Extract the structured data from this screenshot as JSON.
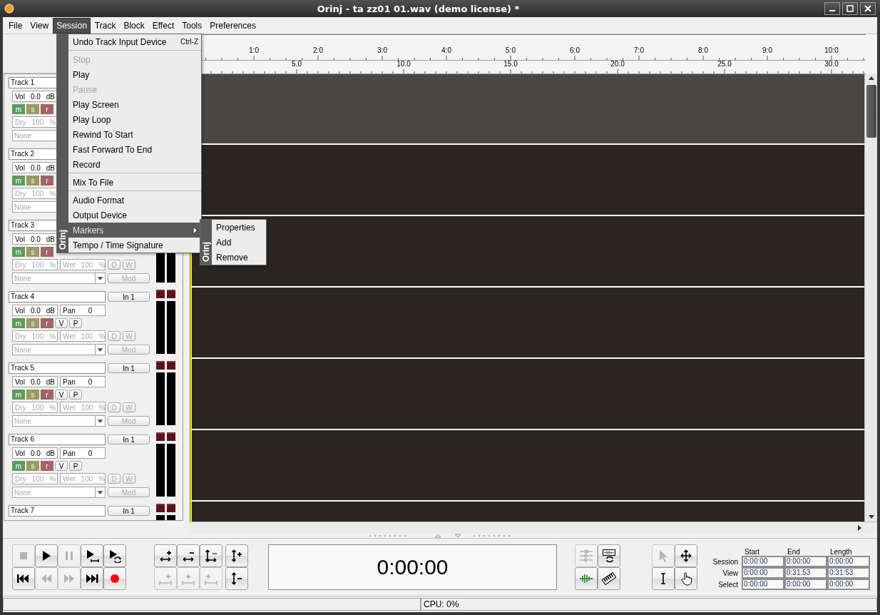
{
  "window": {
    "title": "Orinj - ta zz01 01.wav (demo license) *"
  },
  "menu_bar": [
    {
      "label": "File",
      "selected": false
    },
    {
      "label": "View",
      "selected": false
    },
    {
      "label": "Session",
      "selected": true
    },
    {
      "label": "Track",
      "selected": false
    },
    {
      "label": "Block",
      "selected": false
    },
    {
      "label": "Effect",
      "selected": false
    },
    {
      "label": "Tools",
      "selected": false
    },
    {
      "label": "Preferences",
      "selected": false
    }
  ],
  "session_menu": {
    "brand": "Orinj",
    "items": [
      {
        "kind": "item",
        "label": "Undo Track Input Device",
        "shortcut": "Ctrl-Z",
        "disabled": false,
        "highlighted": false
      },
      {
        "kind": "separator"
      },
      {
        "kind": "item",
        "label": "Stop",
        "disabled": true,
        "highlighted": false
      },
      {
        "kind": "item",
        "label": "Play",
        "disabled": false,
        "highlighted": false
      },
      {
        "kind": "item",
        "label": "Pause",
        "disabled": true,
        "highlighted": false
      },
      {
        "kind": "item",
        "label": "Play Screen",
        "disabled": false,
        "highlighted": false
      },
      {
        "kind": "item",
        "label": "Play Loop",
        "disabled": false,
        "highlighted": false
      },
      {
        "kind": "item",
        "label": "Rewind To Start",
        "disabled": false,
        "highlighted": false
      },
      {
        "kind": "item",
        "label": "Fast Forward To End",
        "disabled": false,
        "highlighted": false
      },
      {
        "kind": "item",
        "label": "Record",
        "disabled": false,
        "highlighted": false
      },
      {
        "kind": "separator"
      },
      {
        "kind": "item",
        "label": "Mix To File",
        "disabled": false,
        "highlighted": false
      },
      {
        "kind": "separator"
      },
      {
        "kind": "item",
        "label": "Audio Format",
        "disabled": false,
        "highlighted": false
      },
      {
        "kind": "item",
        "label": "Output Device",
        "disabled": false,
        "highlighted": false
      },
      {
        "kind": "submenu",
        "label": "Markers",
        "disabled": false,
        "highlighted": true
      },
      {
        "kind": "item",
        "label": "Tempo / Time Signature",
        "disabled": false,
        "highlighted": false
      }
    ]
  },
  "markers_submenu": {
    "brand": "Orinj",
    "items": [
      "Properties",
      "Add",
      "Remove"
    ]
  },
  "ruler": {
    "bars": [
      "1:0",
      "2:0",
      "3:0",
      "4:0",
      "5:0",
      "6:0",
      "7:0",
      "8:0",
      "9:0",
      "10:0"
    ],
    "seconds": [
      "5.0",
      "10.0",
      "15.0",
      "20.0",
      "25.0",
      "30.0"
    ]
  },
  "tracks": [
    {
      "name": "Track 1",
      "vol": {
        "label": "Vol",
        "value": "0.0",
        "unit": "dB"
      },
      "buttons": [
        {
          "kind": "mute",
          "label": "m"
        },
        {
          "kind": "solo",
          "label": "s"
        },
        {
          "kind": "arm",
          "label": "r"
        }
      ],
      "dry": {
        "label": "Dry",
        "value": "100",
        "unit": "%"
      },
      "effect": "None",
      "effects_disabled": true
    },
    {
      "name": "Track 2",
      "vol": {
        "label": "Vol",
        "value": "0.0",
        "unit": "dB"
      },
      "buttons": [
        {
          "kind": "mute",
          "label": "m"
        },
        {
          "kind": "solo",
          "label": "s"
        },
        {
          "kind": "arm",
          "label": "r"
        }
      ],
      "dry": {
        "label": "Dry",
        "value": "100",
        "unit": "%"
      },
      "effect": "None",
      "effects_disabled": true
    },
    {
      "name": "Track 3",
      "vol": {
        "label": "Vol",
        "value": "0.0",
        "unit": "dB"
      },
      "buttons": [
        {
          "kind": "mute",
          "label": "m"
        },
        {
          "kind": "solo",
          "label": "s"
        },
        {
          "kind": "arm",
          "label": "r"
        }
      ],
      "dry": {
        "label": "Dry",
        "value": "100",
        "unit": "%"
      },
      "wet": {
        "label": "Wet",
        "value": "100",
        "unit": "%"
      },
      "sends": [
        "D",
        "W"
      ],
      "effect": "None",
      "mod": "Mod",
      "effects_disabled": true
    },
    {
      "name": "Track 4",
      "input": "In 1",
      "vol": {
        "label": "Vol",
        "value": "0.0",
        "unit": "dB"
      },
      "pan": {
        "label": "Pan",
        "value": "0"
      },
      "buttons": [
        {
          "kind": "mute",
          "label": "m"
        },
        {
          "kind": "solo",
          "label": "s"
        },
        {
          "kind": "arm",
          "label": "r"
        }
      ],
      "toggles": [
        "V",
        "P"
      ],
      "dry": {
        "label": "Dry",
        "value": "100",
        "unit": "%"
      },
      "wet": {
        "label": "Wet",
        "value": "100",
        "unit": "%"
      },
      "sends": [
        "D",
        "W"
      ],
      "effect": "None",
      "mod": "Mod",
      "effects_disabled": true
    },
    {
      "name": "Track 5",
      "input": "In 1",
      "vol": {
        "label": "Vol",
        "value": "0.0",
        "unit": "dB"
      },
      "pan": {
        "label": "Pan",
        "value": "0"
      },
      "buttons": [
        {
          "kind": "mute",
          "label": "m"
        },
        {
          "kind": "solo",
          "label": "s"
        },
        {
          "kind": "arm",
          "label": "r"
        }
      ],
      "toggles": [
        "V",
        "P"
      ],
      "dry": {
        "label": "Dry",
        "value": "100",
        "unit": "%"
      },
      "wet": {
        "label": "Wet",
        "value": "100",
        "unit": "%"
      },
      "sends": [
        "D",
        "W"
      ],
      "effect": "None",
      "mod": "Mod",
      "effects_disabled": true
    },
    {
      "name": "Track 6",
      "input": "In 1",
      "vol": {
        "label": "Vol",
        "value": "0.0",
        "unit": "dB"
      },
      "pan": {
        "label": "Pan",
        "value": "0"
      },
      "buttons": [
        {
          "kind": "mute",
          "label": "m"
        },
        {
          "kind": "solo",
          "label": "s"
        },
        {
          "kind": "arm",
          "label": "r"
        }
      ],
      "toggles": [
        "V",
        "P"
      ],
      "dry": {
        "label": "Dry",
        "value": "100",
        "unit": "%"
      },
      "wet": {
        "label": "Wet",
        "value": "100",
        "unit": "%"
      },
      "sends": [
        "D",
        "W"
      ],
      "effect": "None",
      "mod": "Mod",
      "effects_disabled": true
    },
    {
      "name": "Track 7",
      "input": "In 1"
    }
  ],
  "lanes": [
    {
      "selected": true
    },
    {
      "selected": false
    },
    {
      "selected": false
    },
    {
      "selected": false
    },
    {
      "selected": false
    },
    {
      "selected": false
    },
    {
      "selected": false
    }
  ],
  "transport": [
    {
      "kind": "stop",
      "disabled": true
    },
    {
      "kind": "play",
      "disabled": false
    },
    {
      "kind": "pause",
      "disabled": true
    },
    {
      "kind": "playrange",
      "disabled": false
    },
    {
      "kind": "playloop",
      "disabled": false
    },
    {
      "kind": "start",
      "disabled": false
    },
    {
      "kind": "rewind",
      "disabled": true
    },
    {
      "kind": "forward",
      "disabled": true
    },
    {
      "kind": "end",
      "disabled": false
    },
    {
      "kind": "record",
      "disabled": false
    }
  ],
  "zoom": [
    {
      "kind": "hzoomin",
      "disabled": false
    },
    {
      "kind": "hzoomout",
      "disabled": false
    },
    {
      "kind": "zoomfit",
      "disabled": false
    },
    {
      "kind": "vzoomin",
      "disabled": false
    },
    {
      "kind": "selin",
      "disabled": true
    },
    {
      "kind": "selfit",
      "disabled": true
    },
    {
      "kind": "selout",
      "disabled": true
    },
    {
      "kind": "vzoomout",
      "disabled": false
    }
  ],
  "time_display": "0:00:00",
  "views": [
    {
      "kind": "multiwave",
      "disabled": true
    },
    {
      "kind": "loopwave",
      "disabled": false
    },
    {
      "kind": "wave",
      "disabled": false
    },
    {
      "kind": "piano",
      "disabled": false
    }
  ],
  "tools": [
    {
      "kind": "arrow",
      "disabled": true
    },
    {
      "kind": "move",
      "disabled": false
    },
    {
      "kind": "ibeam",
      "disabled": false
    },
    {
      "kind": "hand",
      "disabled": false
    }
  ],
  "time_table": {
    "columns": [
      "Start",
      "End",
      "Length"
    ],
    "rows": [
      {
        "label": "Session",
        "values": [
          "0:00:00",
          "0:00:00",
          "0:00:00"
        ]
      },
      {
        "label": "View",
        "values": [
          "0:00:00",
          "0:31:53",
          "0:31:53"
        ]
      },
      {
        "label": "Select",
        "values": [
          "0:00:00",
          "0:00:00",
          "0:00:00"
        ]
      }
    ]
  },
  "status_bar": {
    "cpu": "CPU: 0%"
  }
}
